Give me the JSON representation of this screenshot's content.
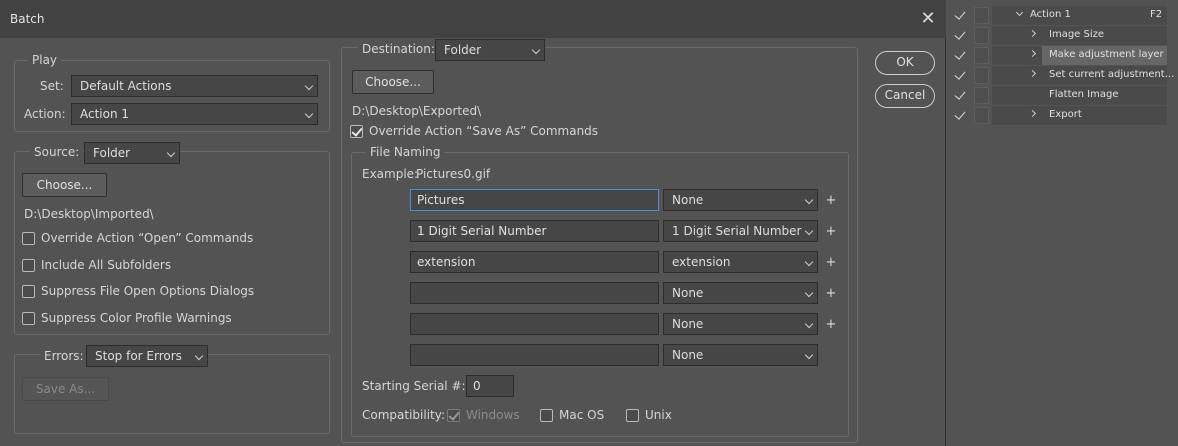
{
  "dialog": {
    "title": "Batch",
    "ok_label": "OK",
    "cancel_label": "Cancel",
    "play": {
      "legend": "Play",
      "set_label": "Set:",
      "set_value": "Default Actions",
      "action_label": "Action:",
      "action_value": "Action 1"
    },
    "source": {
      "label": "Source:",
      "value": "Folder",
      "choose_label": "Choose...",
      "path": "D:\\Desktop\\Imported\\",
      "options": [
        {
          "label": "Override Action “Open” Commands",
          "checked": false
        },
        {
          "label": "Include All Subfolders",
          "checked": false
        },
        {
          "label": "Suppress File Open Options Dialogs",
          "checked": false
        },
        {
          "label": "Suppress Color Profile Warnings",
          "checked": false
        }
      ]
    },
    "errors": {
      "label": "Errors:",
      "value": "Stop for Errors",
      "save_as_label": "Save As..."
    },
    "destination": {
      "label": "Destination:",
      "value": "Folder",
      "choose_label": "Choose...",
      "path": "D:\\Desktop\\Exported\\",
      "override_label": "Override Action “Save As” Commands",
      "override_checked": true
    },
    "file_naming": {
      "legend": "File Naming",
      "example_label": "Example:",
      "example_value": "Pictures0.gif",
      "rows": [
        {
          "text": "Pictures",
          "option": "None",
          "plus": "+"
        },
        {
          "text": "1 Digit Serial Number",
          "option": "1 Digit Serial Number",
          "plus": "+"
        },
        {
          "text": "extension",
          "option": "extension",
          "plus": "+"
        },
        {
          "text": "",
          "option": "None",
          "plus": "+"
        },
        {
          "text": "",
          "option": "None",
          "plus": "+"
        },
        {
          "text": "",
          "option": "None",
          "plus": ""
        }
      ],
      "serial_label": "Starting Serial #:",
      "serial_value": "0",
      "compat_label": "Compatibility:",
      "compat": [
        {
          "label": "Windows",
          "checked": true,
          "disabled": true
        },
        {
          "label": "Mac OS",
          "checked": false,
          "disabled": false
        },
        {
          "label": "Unix",
          "checked": false,
          "disabled": false
        }
      ]
    }
  },
  "actions_panel": {
    "items": [
      {
        "label": "Action 1",
        "shortcut": "F2",
        "chevron": "down",
        "selected": false,
        "level": 0
      },
      {
        "label": "Image Size",
        "shortcut": "",
        "chevron": "right",
        "selected": false,
        "level": 1
      },
      {
        "label": "Make adjustment layer",
        "shortcut": "",
        "chevron": "right",
        "selected": true,
        "level": 1
      },
      {
        "label": "Set current adjustment...",
        "shortcut": "",
        "chevron": "right",
        "selected": false,
        "level": 1
      },
      {
        "label": "Flatten Image",
        "shortcut": "",
        "chevron": "",
        "selected": false,
        "level": 1
      },
      {
        "label": "Export",
        "shortcut": "",
        "chevron": "right",
        "selected": false,
        "level": 1
      }
    ]
  }
}
